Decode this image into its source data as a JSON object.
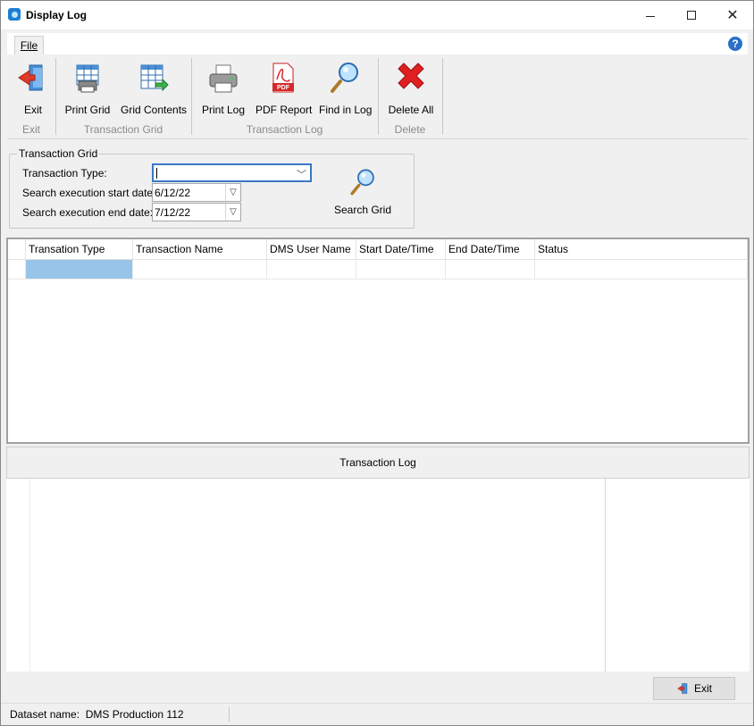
{
  "window": {
    "title": "Display Log"
  },
  "tabs": {
    "file": "File"
  },
  "ribbon": {
    "exit": "Exit",
    "print_grid": "Print Grid",
    "grid_contents": "Grid Contents",
    "print_log": "Print Log",
    "pdf_report": "PDF Report",
    "find_in_log": "Find in Log",
    "delete_all": "Delete All",
    "groups": {
      "exit": "Exit",
      "transaction_grid": "Transaction Grid",
      "transaction_log": "Transaction Log",
      "delete": "Delete"
    },
    "pdf_badge": "PDF"
  },
  "filter": {
    "legend": "Transaction Grid",
    "type_label": "Transaction Type:",
    "type_value": "",
    "start_label": "Search execution start date:",
    "start_value": "6/12/22",
    "end_label": "Search execution end date:",
    "end_value": "7/12/22",
    "search_button": "Search Grid"
  },
  "grid": {
    "columns": [
      "Transation Type",
      "Transaction Name",
      "DMS User Name",
      "Start Date/Time",
      "End Date/Time",
      "Status"
    ]
  },
  "log": {
    "header": "Transaction Log"
  },
  "footer": {
    "exit_button": "Exit",
    "dataset_label": "Dataset name:",
    "dataset_value": "DMS Production 112"
  },
  "colors": {
    "accent": "#3a76c8",
    "selection": "#99c4ea",
    "delete_red": "#e02020"
  }
}
